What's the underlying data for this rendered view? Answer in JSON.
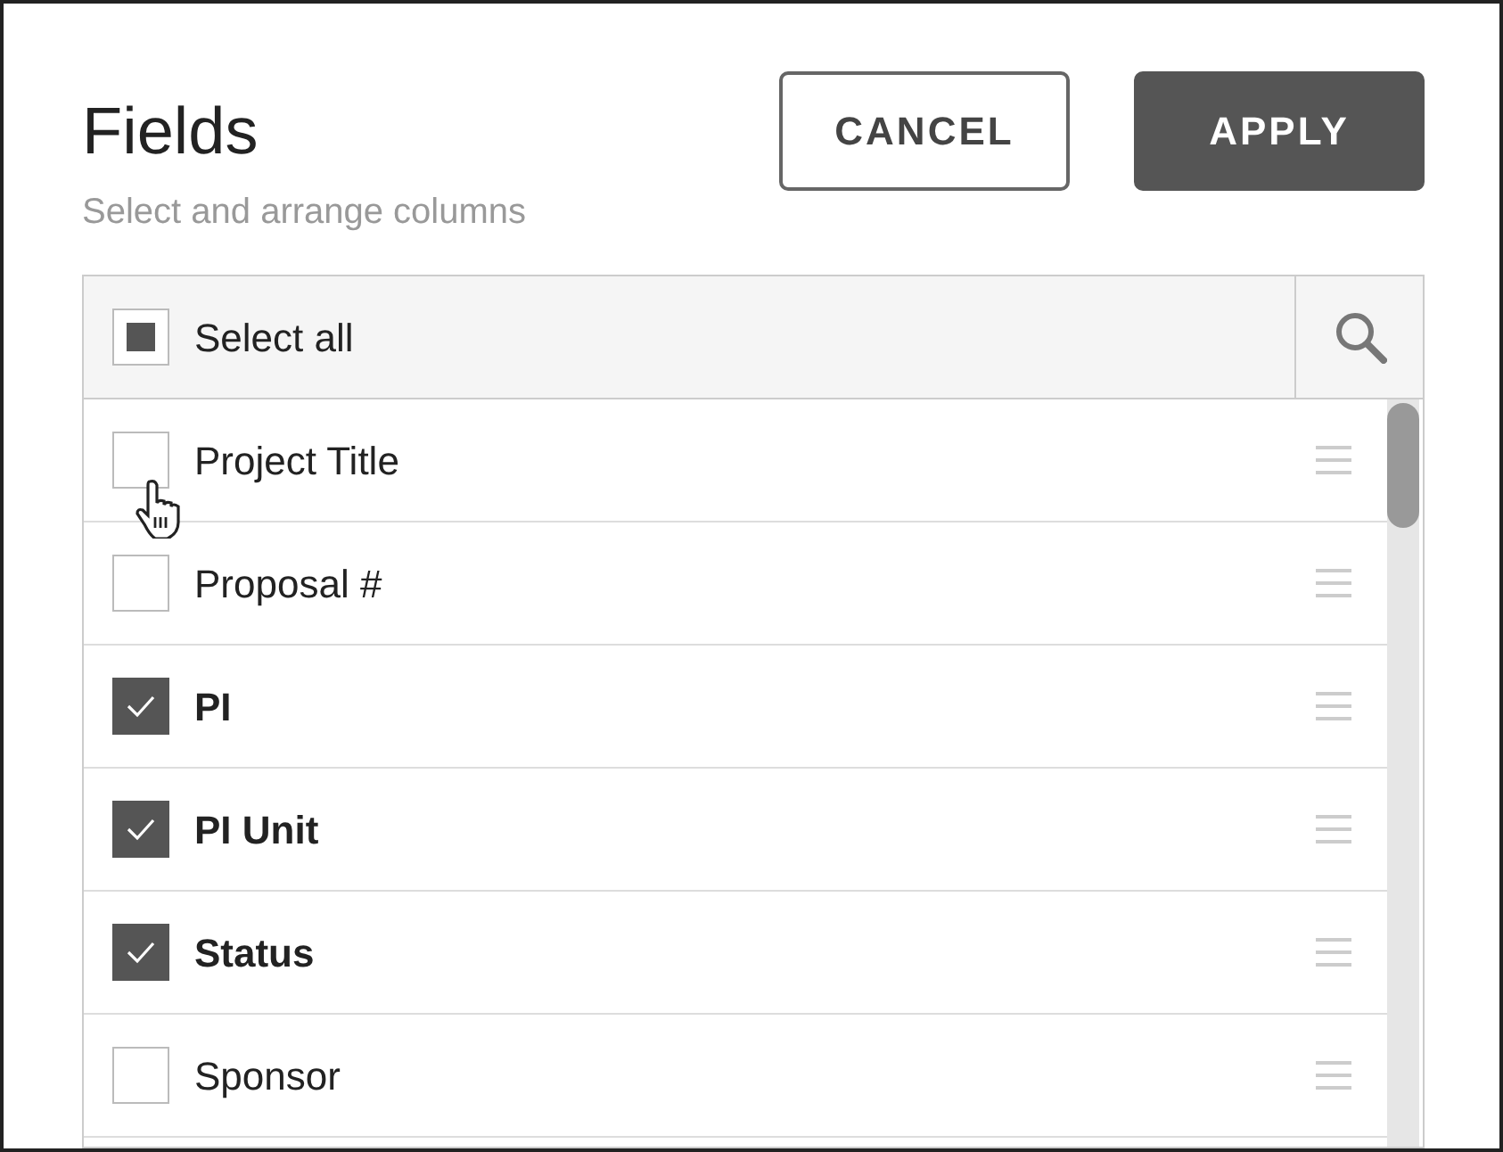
{
  "title": "Fields",
  "subtitle": "Select and arrange columns",
  "buttons": [
    {
      "label": "CANCEL",
      "kind": "secondary"
    },
    {
      "label": "APPLY",
      "kind": "primary"
    }
  ],
  "select_all": {
    "label": "Select all",
    "indeterminate": true
  },
  "fields": [
    {
      "label": "Project Title",
      "checked": false
    },
    {
      "label": "Proposal #",
      "checked": false
    },
    {
      "label": "PI",
      "checked": true
    },
    {
      "label": "PI Unit",
      "checked": true
    },
    {
      "label": "Status",
      "checked": true
    },
    {
      "label": "Sponsor",
      "checked": false
    }
  ]
}
